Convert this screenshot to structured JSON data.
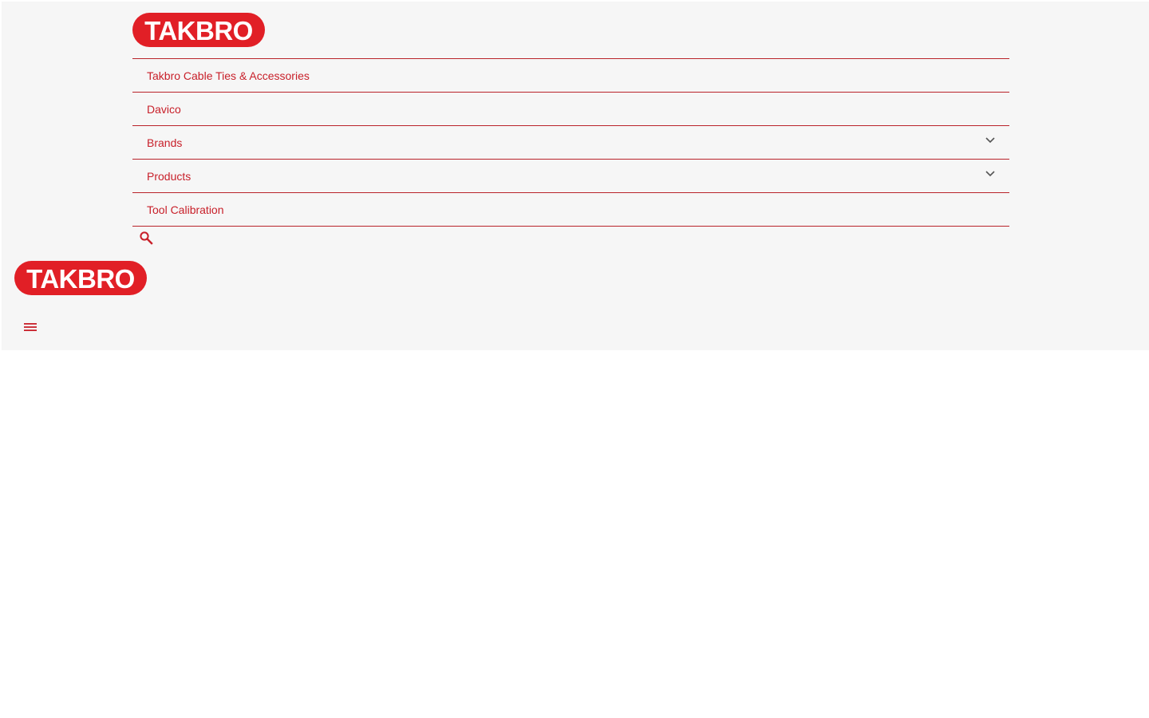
{
  "brand": {
    "logo_text": "TAKBRO",
    "color": "#e11f26"
  },
  "nav": {
    "items": [
      {
        "label": "Takbro Cable Ties & Accessories",
        "has_dropdown": false
      },
      {
        "label": "Davico",
        "has_dropdown": false
      },
      {
        "label": "Brands",
        "has_dropdown": true,
        "icon": "chevron-down-icon"
      },
      {
        "label": "Products",
        "has_dropdown": true,
        "icon": "chevron-down-icon"
      },
      {
        "label": "Tool Calibration",
        "has_dropdown": false
      }
    ],
    "text_color": "#c8202a",
    "divider_color": "#b9232a"
  },
  "search": {
    "icon": "search-icon"
  },
  "mobile": {
    "menu_icon": "hamburger-menu-icon"
  }
}
